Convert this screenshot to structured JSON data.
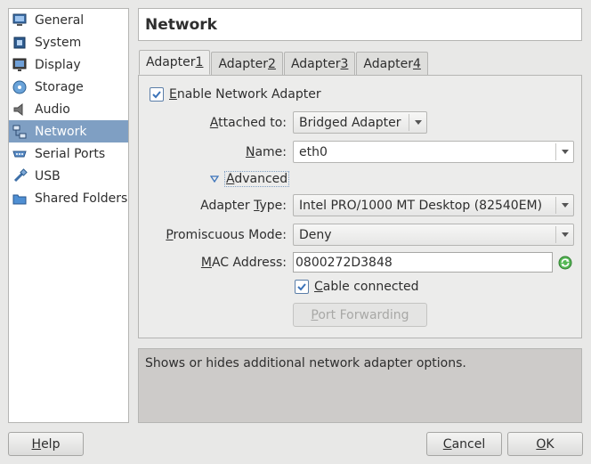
{
  "sidebar": {
    "items": [
      {
        "label": "General",
        "icon": "monitor-icon"
      },
      {
        "label": "System",
        "icon": "chip-icon"
      },
      {
        "label": "Display",
        "icon": "display-icon"
      },
      {
        "label": "Storage",
        "icon": "storage-icon"
      },
      {
        "label": "Audio",
        "icon": "speaker-icon"
      },
      {
        "label": "Network",
        "icon": "network-icon",
        "selected": true
      },
      {
        "label": "Serial Ports",
        "icon": "serial-port-icon"
      },
      {
        "label": "USB",
        "icon": "usb-icon"
      },
      {
        "label": "Shared Folders",
        "icon": "folder-icon"
      }
    ]
  },
  "page": {
    "title": "Network"
  },
  "tabs": [
    {
      "pre": "Adapter ",
      "accel": "1",
      "active": true
    },
    {
      "pre": "Adapter ",
      "accel": "2"
    },
    {
      "pre": "Adapter ",
      "accel": "3"
    },
    {
      "pre": "Adapter ",
      "accel": "4"
    }
  ],
  "form": {
    "enable": {
      "accel": "E",
      "rest": "nable Network Adapter",
      "checked": true
    },
    "attached": {
      "accel": "A",
      "rest": "ttached to:",
      "value": "Bridged Adapter"
    },
    "name": {
      "accel": "N",
      "rest": "ame:",
      "value": "eth0"
    },
    "advanced": {
      "accel": "A",
      "rest": "dvanced"
    },
    "adapter_type": {
      "pre": "Adapter ",
      "accel": "T",
      "rest": "ype:",
      "value": "Intel PRO/1000 MT Desktop (82540EM)"
    },
    "promiscuous": {
      "accel": "P",
      "rest": "romiscuous Mode:",
      "value": "Deny"
    },
    "mac": {
      "accel": "M",
      "rest": "AC Address:",
      "value": "0800272D3848"
    },
    "cable": {
      "accel": "C",
      "rest": "able connected",
      "checked": true
    },
    "port_forwarding": {
      "accel": "P",
      "rest": "ort Forwarding"
    }
  },
  "description": "Shows or hides additional network adapter options.",
  "footer": {
    "help": {
      "accel": "H",
      "rest": "elp"
    },
    "cancel": {
      "accel": "C",
      "rest": "ancel"
    },
    "ok": {
      "accel": "O",
      "rest": "K"
    }
  },
  "colors": {
    "selection": "#7f9fc3",
    "check": "#3b73b9",
    "refresh": "#3aa43a"
  }
}
